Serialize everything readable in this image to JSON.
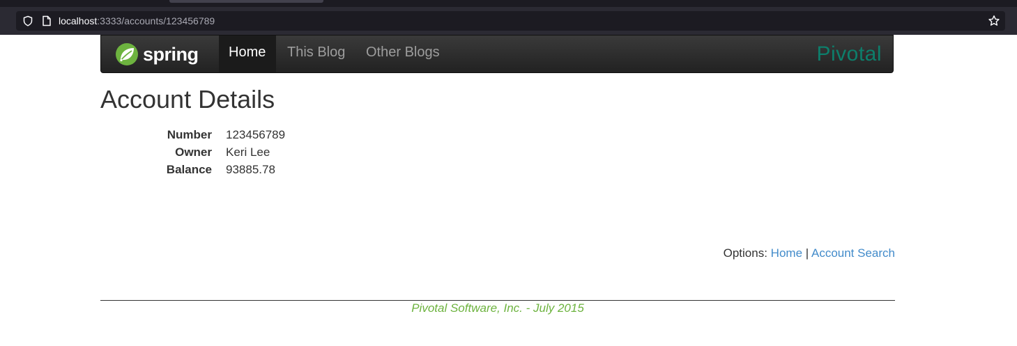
{
  "browser": {
    "url_host": "localhost",
    "url_rest": ":3333/accounts/123456789"
  },
  "navbar": {
    "brand": "spring",
    "items": [
      {
        "label": "Home",
        "active": true
      },
      {
        "label": "This Blog",
        "active": false
      },
      {
        "label": "Other Blogs",
        "active": false
      }
    ],
    "partner_logo": "Pivotal"
  },
  "page": {
    "title": "Account Details",
    "details": [
      {
        "label": "Number",
        "value": "123456789"
      },
      {
        "label": "Owner",
        "value": "Keri Lee"
      },
      {
        "label": "Balance",
        "value": "93885.78"
      }
    ],
    "options": {
      "prefix": "Options:",
      "links": [
        "Home",
        "Account Search"
      ],
      "separator": "|"
    }
  },
  "footer": {
    "text": "Pivotal Software, Inc. - July 2015"
  },
  "colors": {
    "link": "#428bca",
    "footer": "#6db33f",
    "spring_green": "#6db33f",
    "pivotal_green": "#0d7e6b"
  }
}
